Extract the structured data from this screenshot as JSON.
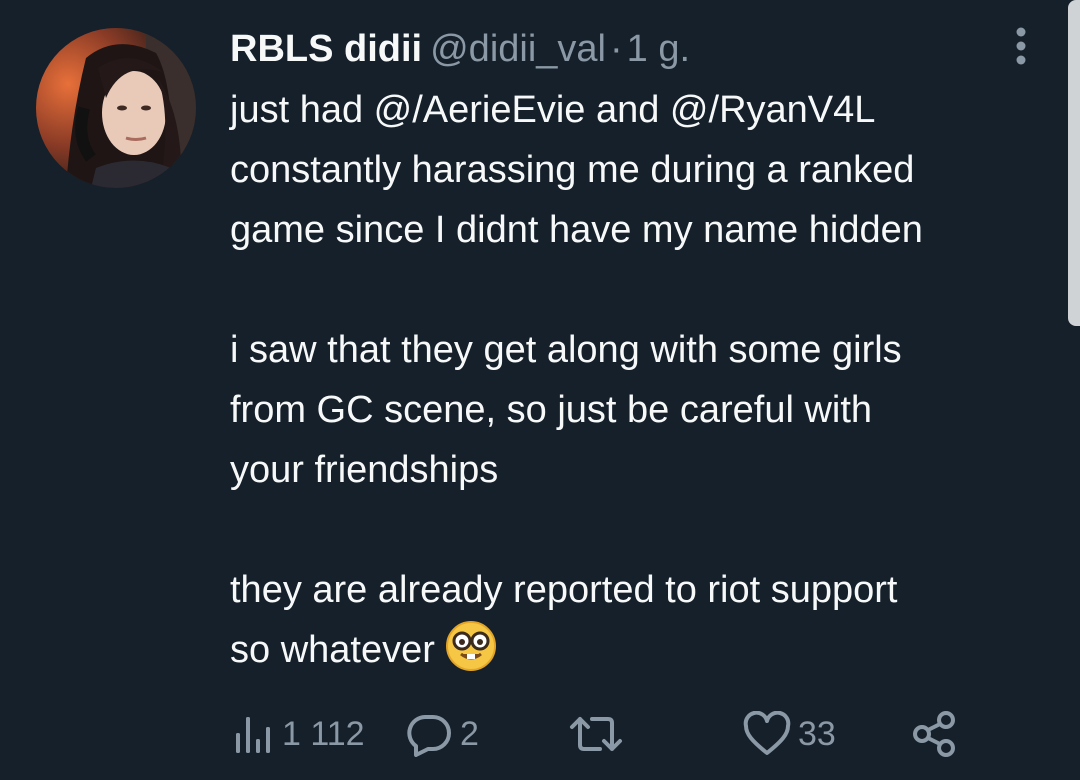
{
  "tweet": {
    "author": {
      "display_name": "RBLS didii",
      "handle": "@didii_val",
      "separator": "·",
      "time": "1 g."
    },
    "lines": [
      "just had @/AerieEvie and @/RyanV4L",
      "constantly harassing me during a ranked",
      "game since I didnt have my name hidden",
      "",
      "i saw that they get along with some girls",
      "from GC scene, so just be careful with",
      "your friendships",
      "",
      "they are already reported to riot support",
      "so whatever"
    ],
    "emoji": "nerd-face-emoji"
  },
  "actions": {
    "views": {
      "icon": "views-bar-chart-icon",
      "count": "1 112"
    },
    "reply": {
      "icon": "reply-bubble-icon",
      "count": "2"
    },
    "retweet": {
      "icon": "retweet-icon",
      "count": ""
    },
    "like": {
      "icon": "heart-icon",
      "count": "33"
    },
    "share": {
      "icon": "share-icon"
    }
  },
  "colors": {
    "background": "#15202b",
    "text": "#f7f9f9",
    "secondary": "#8b98a5"
  }
}
